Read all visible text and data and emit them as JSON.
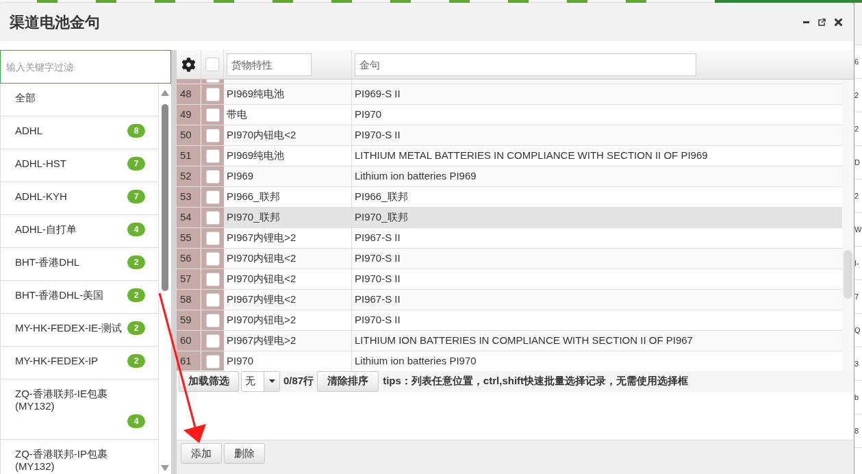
{
  "background_page": {
    "column_fragments": [
      "6",
      "2",
      "2",
      "D",
      "2",
      "W",
      "I-",
      "7",
      "Q",
      "3",
      "b",
      "8"
    ]
  },
  "dialog": {
    "title": "渠道电池金句"
  },
  "filter": {
    "placeholder": "输入关键字过滤"
  },
  "channel_list": [
    {
      "label": "全部",
      "selected": false
    },
    {
      "label": "ADHL",
      "count": "8",
      "selected": false
    },
    {
      "label": "ADHL-HST",
      "count": "7",
      "selected": false
    },
    {
      "label": "ADHL-KYH",
      "count": "7",
      "selected": false
    },
    {
      "label": "ADHL-自打单",
      "count": "4",
      "selected": false
    },
    {
      "label": "BHT-香港DHL",
      "count": "2",
      "selected": false
    },
    {
      "label": "BHT-香港DHL-美国",
      "count": "2",
      "selected": false
    },
    {
      "label": "MY-HK-FEDEX-IE-测试",
      "count": "2",
      "selected": false
    },
    {
      "label": "MY-HK-FEDEX-IP",
      "count": "2",
      "selected": false
    },
    {
      "label": "ZQ-香港联邦-IE包裹(MY132)",
      "count": "4",
      "selected": false
    },
    {
      "label": "ZQ-香港联邦-IP包裹(MY132)",
      "selected": false
    }
  ],
  "table": {
    "select_all_checked": false,
    "filters": [
      {
        "placeholder": "货物特性"
      },
      {
        "placeholder": "金句"
      }
    ],
    "rows": [
      {
        "number": "48",
        "checked": false,
        "highlighted": false,
        "cargo": "PI969纯电池",
        "phrase": "PI969-S II"
      },
      {
        "number": "49",
        "checked": false,
        "highlighted": false,
        "cargo": "带电",
        "phrase": "PI970"
      },
      {
        "number": "50",
        "checked": false,
        "highlighted": false,
        "cargo": "PI970内钮电<2",
        "phrase": "PI970-S II"
      },
      {
        "number": "51",
        "checked": false,
        "highlighted": false,
        "cargo": "PI969纯电池",
        "phrase": "LITHIUM METAL BATTERIES IN COMPLIANCE WITH SECTION II OF PI969"
      },
      {
        "number": "52",
        "checked": false,
        "highlighted": false,
        "cargo": "PI969",
        "phrase": "Lithium ion batteries PI969"
      },
      {
        "number": "53",
        "checked": false,
        "highlighted": false,
        "cargo": "PI966_联邦",
        "phrase": "PI966_联邦"
      },
      {
        "number": "54",
        "checked": false,
        "highlighted": true,
        "cargo": "PI970_联邦",
        "phrase": "PI970_联邦"
      },
      {
        "number": "55",
        "checked": false,
        "highlighted": false,
        "cargo": "PI967内锂电>2",
        "phrase": "PI967-S II"
      },
      {
        "number": "56",
        "checked": false,
        "highlighted": false,
        "cargo": "PI970内钮电<2",
        "phrase": "PI970-S II"
      },
      {
        "number": "57",
        "checked": false,
        "highlighted": false,
        "cargo": "PI970内钮电<2",
        "phrase": "PI970-S II"
      },
      {
        "number": "58",
        "checked": false,
        "highlighted": false,
        "cargo": "PI967内锂电<2",
        "phrase": "PI967-S II"
      },
      {
        "number": "59",
        "checked": false,
        "highlighted": false,
        "cargo": "PI970内钮电>2",
        "phrase": "PI970-S II"
      },
      {
        "number": "60",
        "checked": false,
        "highlighted": false,
        "cargo": "PI967内锂电>2",
        "phrase": "LITHIUM ION BATTERIES IN COMPLIANCE WITH SECTION II OF PI967"
      },
      {
        "number": "61",
        "checked": false,
        "highlighted": false,
        "cargo": "PI970",
        "phrase": "Lithium ion batteries PI970"
      }
    ]
  },
  "toolbar": {
    "load_filter_button": "加载筛选",
    "view_select": {
      "value": "无"
    },
    "row_count": "0/87行",
    "clear_sort_button": "清除排序",
    "tips": "tips：列表任意位置，ctrl,shift快速批量选择记录，无需使用选择框"
  },
  "footer": {
    "buttons": [
      "添加",
      "删除"
    ]
  }
}
